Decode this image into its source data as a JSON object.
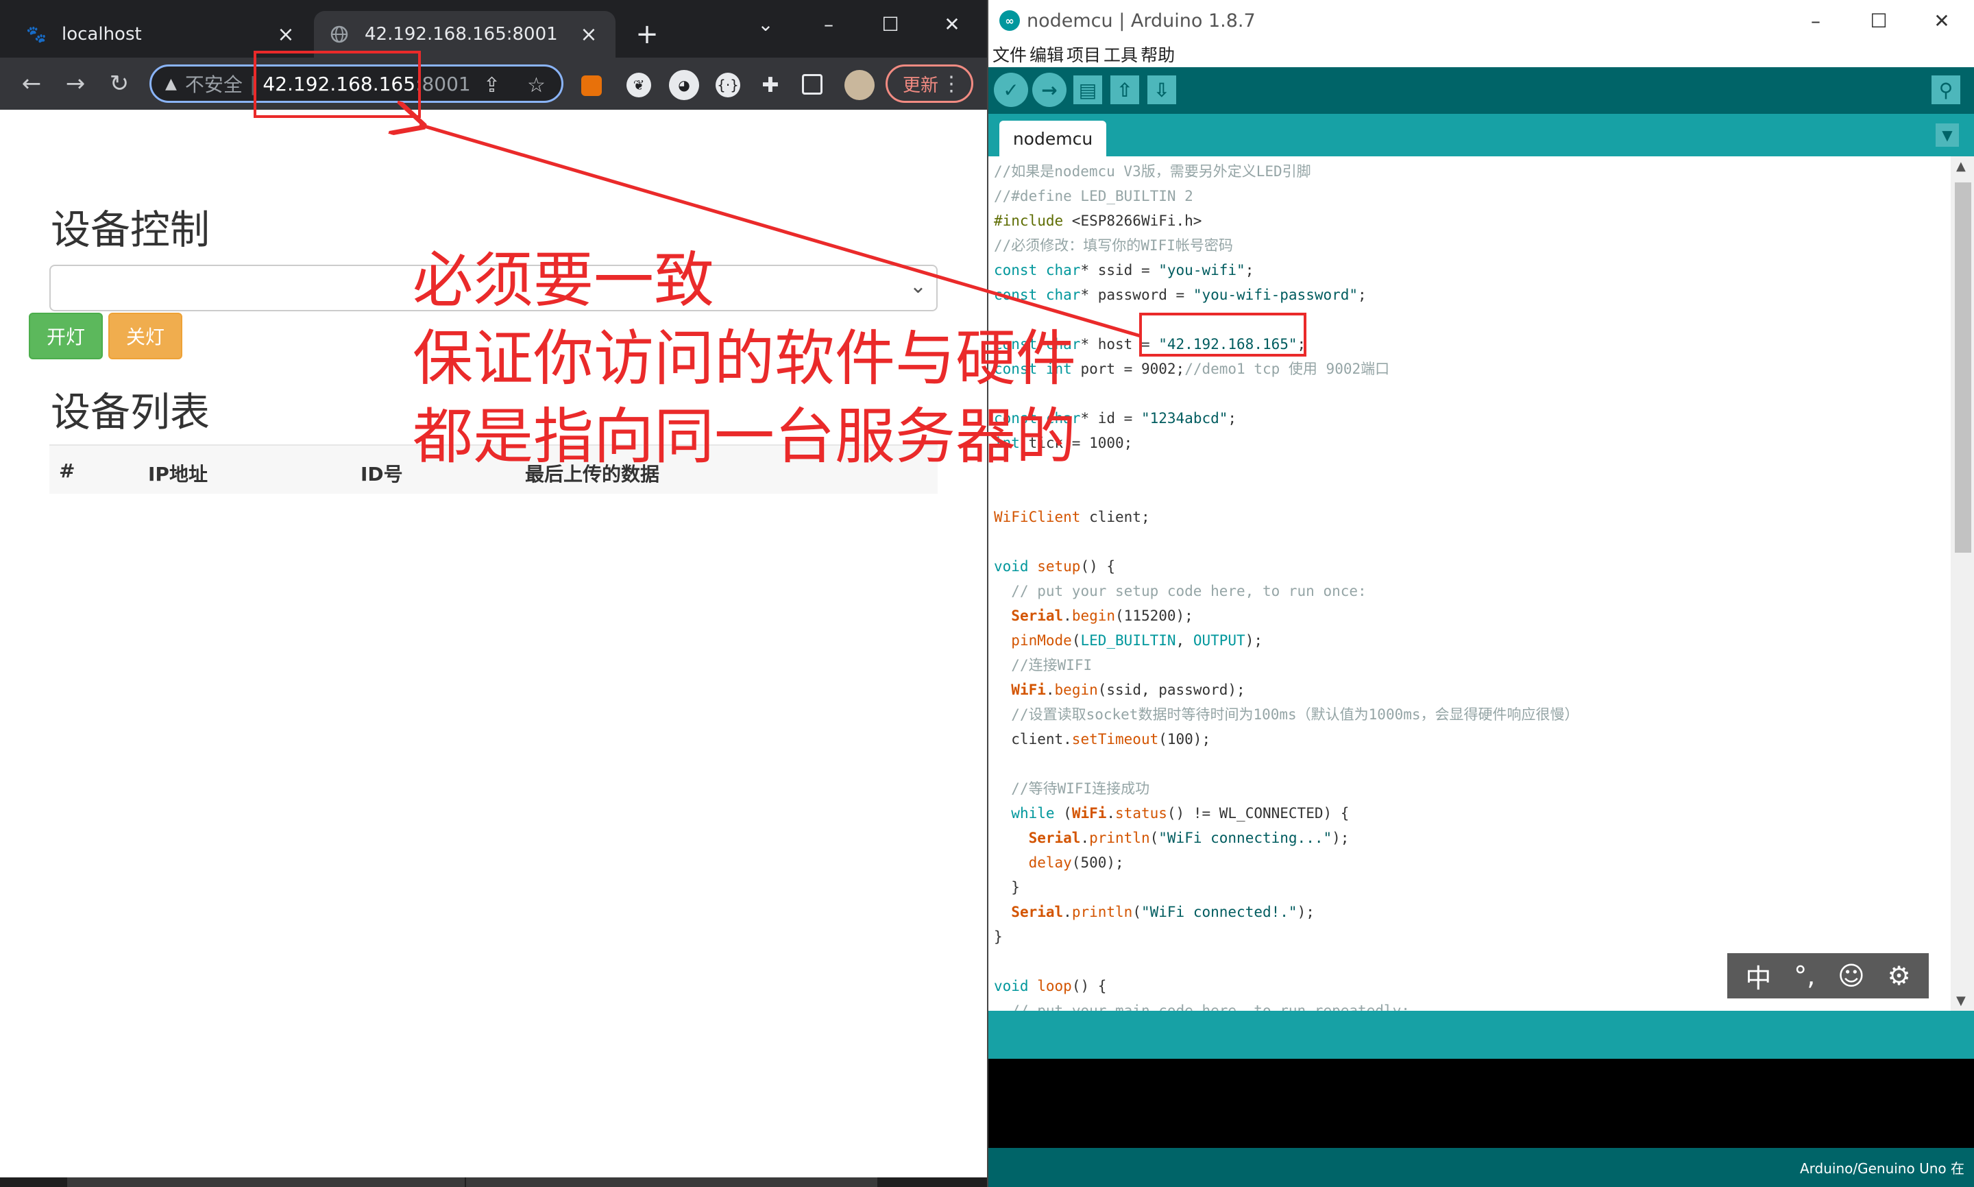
{
  "browser": {
    "tabs": [
      {
        "title": "localhost",
        "active": false,
        "icon": "paw-icon"
      },
      {
        "title": "42.192.168.165:8001",
        "active": true,
        "icon": "globe-icon"
      }
    ],
    "address_bar": {
      "security_label": "不安全",
      "host": "42.192.168.165",
      "port": ":8001"
    },
    "update_label": "更新"
  },
  "webpage": {
    "control_heading": "设备控制",
    "on_button": "开灯",
    "off_button": "关灯",
    "list_heading": "设备列表",
    "table_headers": [
      "#",
      "IP地址",
      "ID号",
      "最后上传的数据"
    ]
  },
  "annotation": {
    "text": "必须要一致\n保证你访问的软件与硬件\n都是指向同一台服务器的",
    "color": "#ea2a2a"
  },
  "arduino": {
    "window_title": "nodemcu | Arduino 1.8.7",
    "menu": [
      "文件",
      "编辑",
      "项目",
      "工具",
      "帮助"
    ],
    "sketch_tab": "nodemcu",
    "status_text": "Arduino/Genuino Uno 在",
    "ime_bar": [
      "中",
      "°,",
      "☺",
      "⚙"
    ],
    "code_lines": [
      "//如果是nodemcu V3版，需要另外定义LED引脚",
      "//#define LED_BUILTIN 2",
      "#include <ESP8266WiFi.h>",
      "//必须修改：填写你的WIFI帐号密码",
      "const char* ssid = \"you-wifi\";",
      "const char* password = \"you-wifi-password\";",
      "",
      "const char* host = \"42.192.168.165\";",
      "const int port = 9002;//demo1 tcp 使用 9002端口",
      "",
      "const char* id = \"1234abcd\";",
      "int tick = 1000;",
      "",
      "",
      "WiFiClient client;",
      "",
      "void setup() {",
      "  // put your setup code here, to run once:",
      "  Serial.begin(115200);",
      "  pinMode(LED_BUILTIN, OUTPUT);",
      "  //连接WIFI",
      "  WiFi.begin(ssid, password);",
      "  //设置读取socket数据时等待时间为100ms（默认值为1000ms，会显得硬件响应很慢）",
      "  client.setTimeout(100);",
      "",
      "  //等待WIFI连接成功",
      "  while (WiFi.status() != WL_CONNECTED) {",
      "    Serial.println(\"WiFi connecting...\");",
      "    delay(500);",
      "  }",
      "  Serial.println(\"WiFi connected!.\");",
      "}",
      "",
      "void loop() {",
      "  // put your main code here, to run repeatedly:"
    ]
  }
}
